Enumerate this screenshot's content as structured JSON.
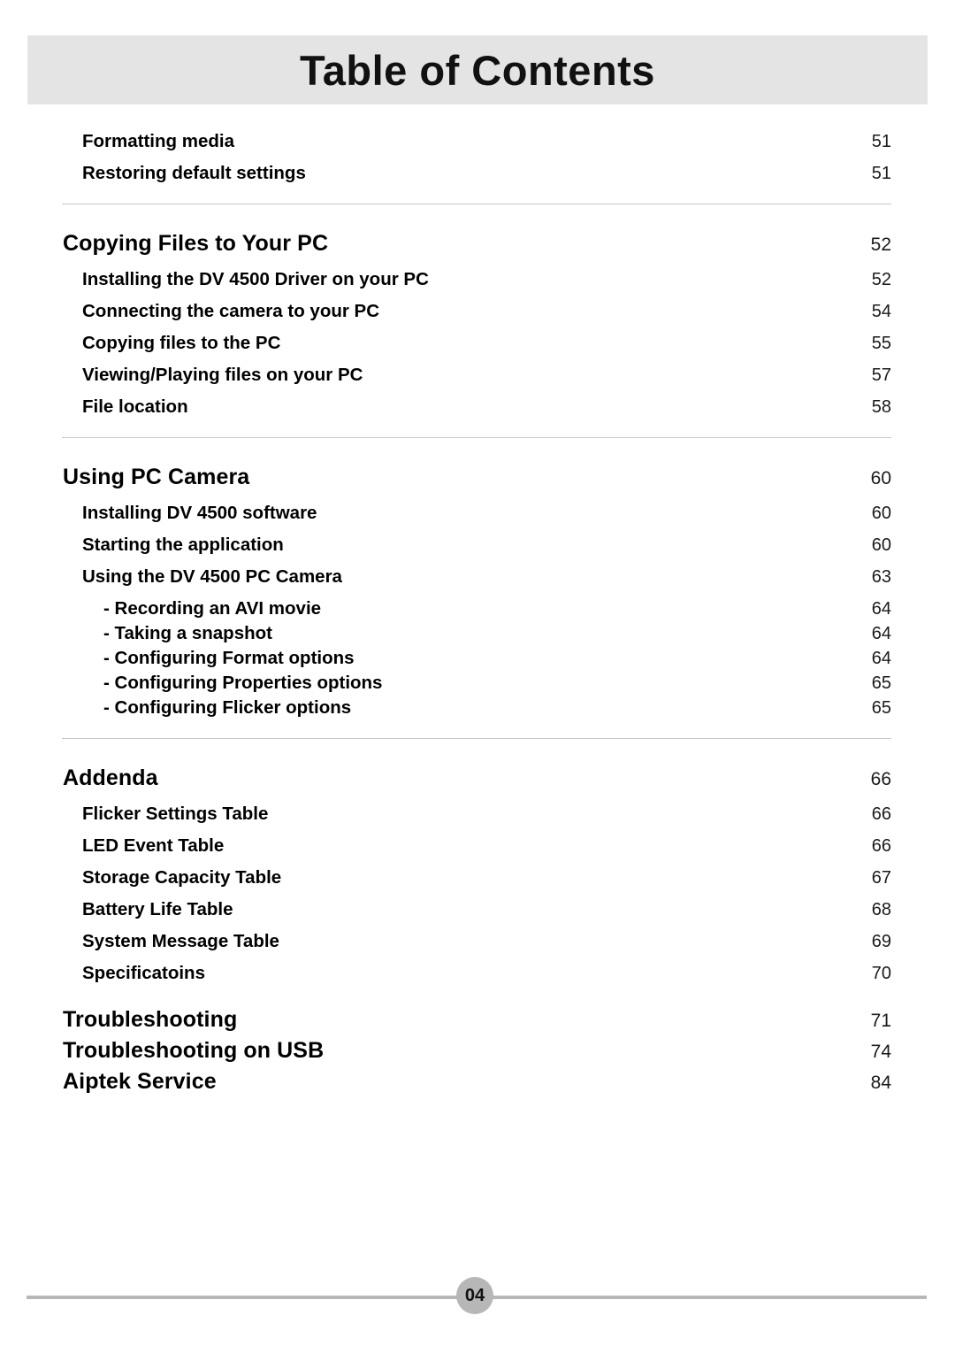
{
  "header": {
    "title": "Table of Contents",
    "band_color": "#e4e4e4"
  },
  "footer": {
    "page_number": "04",
    "rule_color": "#b7b7b7"
  },
  "entries": [
    {
      "level": 2,
      "label": "Formatting media",
      "page": "51"
    },
    {
      "level": 2,
      "label": "Restoring default settings",
      "page": "51"
    },
    {
      "level": 1,
      "label": "Copying Files to Your PC",
      "page": "52"
    },
    {
      "level": 2,
      "label": "Installing the DV 4500 Driver on your PC",
      "page": "52"
    },
    {
      "level": 2,
      "label": "Connecting the camera to your PC",
      "page": "54"
    },
    {
      "level": 2,
      "label": "Copying files to the PC",
      "page": "55"
    },
    {
      "level": 2,
      "label": "Viewing/Playing files on your PC",
      "page": "57"
    },
    {
      "level": 2,
      "label": "File location",
      "page": "58"
    },
    {
      "level": 1,
      "label": "Using PC Camera",
      "page": "60"
    },
    {
      "level": 2,
      "label": "Installing DV 4500 software",
      "page": "60"
    },
    {
      "level": 2,
      "label": "Starting the application",
      "page": "60"
    },
    {
      "level": 2,
      "label": "Using the DV 4500 PC Camera",
      "page": "63"
    },
    {
      "level": 3,
      "label": "- Recording an AVI movie",
      "page": "64"
    },
    {
      "level": 3,
      "label": "- Taking a snapshot",
      "page": "64"
    },
    {
      "level": 3,
      "label": "- Configuring Format options",
      "page": "64"
    },
    {
      "level": 3,
      "label": "- Configuring Properties options",
      "page": "65"
    },
    {
      "level": 3,
      "label": "- Configuring Flicker options",
      "page": "65"
    },
    {
      "level": 1,
      "label": "Addenda",
      "page": "66"
    },
    {
      "level": 2,
      "label": "Flicker Settings Table",
      "page": "66"
    },
    {
      "level": 2,
      "label": "LED Event Table",
      "page": "66"
    },
    {
      "level": 2,
      "label": "Storage Capacity Table",
      "page": "67"
    },
    {
      "level": 2,
      "label": "Battery Life Table",
      "page": "68"
    },
    {
      "level": 2,
      "label": "System Message Table",
      "page": "69"
    },
    {
      "level": 2,
      "label": "Specificatoins",
      "page": "70"
    },
    {
      "level": 1,
      "label": "Troubleshooting",
      "page": "71"
    },
    {
      "level": 1,
      "label": "Troubleshooting on USB",
      "page": "74"
    },
    {
      "level": 1,
      "label": "Aiptek Service",
      "page": "84"
    }
  ]
}
